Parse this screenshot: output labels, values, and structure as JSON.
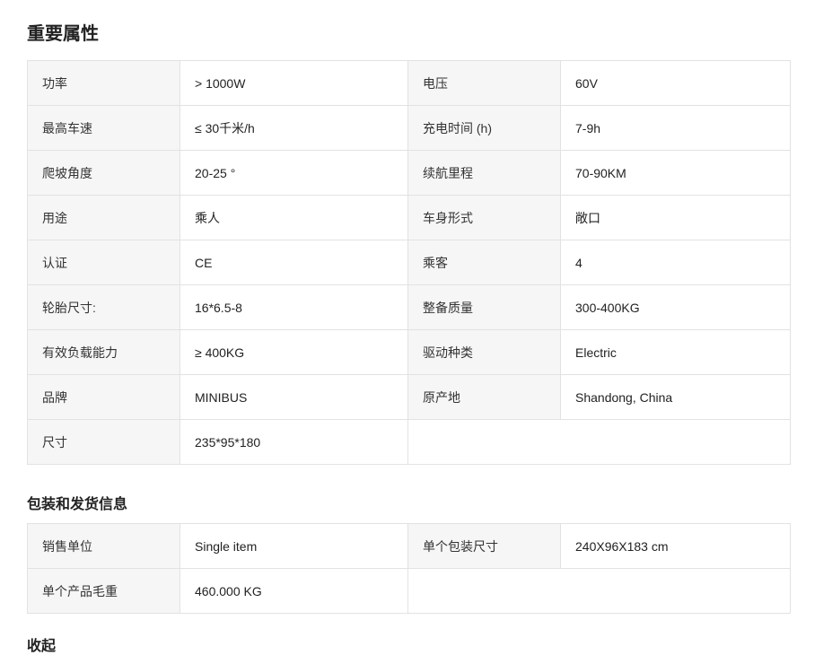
{
  "key_attributes": {
    "title": "重要属性",
    "rows": [
      [
        {
          "k": "功率",
          "v": "> 1000W"
        },
        {
          "k": "电压",
          "v": "60V"
        }
      ],
      [
        {
          "k": "最高车速",
          "v": "≤ 30千米/h"
        },
        {
          "k": "充电时间 (h)",
          "v": "7-9h"
        }
      ],
      [
        {
          "k": "爬坡角度",
          "v": "20-25 °"
        },
        {
          "k": "续航里程",
          "v": "70-90KM"
        }
      ],
      [
        {
          "k": "用途",
          "v": "乘人"
        },
        {
          "k": "车身形式",
          "v": "敞口"
        }
      ],
      [
        {
          "k": "认证",
          "v": "CE"
        },
        {
          "k": "乘客",
          "v": "4"
        }
      ],
      [
        {
          "k": "轮胎尺寸:",
          "v": "16*6.5-8"
        },
        {
          "k": "整备质量",
          "v": "300-400KG"
        }
      ],
      [
        {
          "k": "有效负载能力",
          "v": "≥ 400KG"
        },
        {
          "k": "驱动种类",
          "v": "Electric"
        }
      ],
      [
        {
          "k": "品牌",
          "v": "MINIBUS"
        },
        {
          "k": "原产地",
          "v": "Shandong, China"
        }
      ],
      [
        {
          "k": "尺寸",
          "v": "235*95*180"
        }
      ]
    ]
  },
  "packaging": {
    "title": "包装和发货信息",
    "rows": [
      [
        {
          "k": "销售单位",
          "v": "Single item"
        },
        {
          "k": "单个包装尺寸",
          "v": "240X96X183 cm"
        }
      ],
      [
        {
          "k": "单个产品毛重",
          "v": "460.000 KG"
        }
      ]
    ]
  },
  "footer_cut": "收起"
}
